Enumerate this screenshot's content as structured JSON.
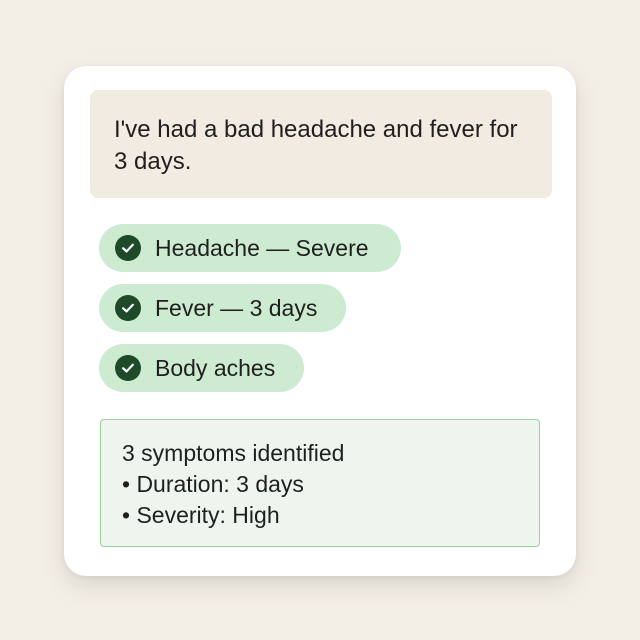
{
  "conversation": {
    "user_message": "I've had a bad headache and fever for 3 days."
  },
  "symptom_chips": [
    {
      "label": "Headache — Severe",
      "icon": "check-circle-icon"
    },
    {
      "label": "Fever — 3 days",
      "icon": "check-circle-icon"
    },
    {
      "label": "Body aches",
      "icon": "check-circle-icon"
    }
  ],
  "summary": {
    "title": "3 symptoms identified",
    "bullets": [
      "• Duration: 3 days",
      "• Severity: High"
    ]
  },
  "colors": {
    "background": "#F3EEE6",
    "card": "#FFFFFF",
    "message_bubble": "#F1EBE1",
    "chip_fill": "#CDEBD0",
    "check_icon": "#1F4A2A",
    "summary_fill": "#EEF5EE",
    "summary_border": "#9DD09F"
  }
}
